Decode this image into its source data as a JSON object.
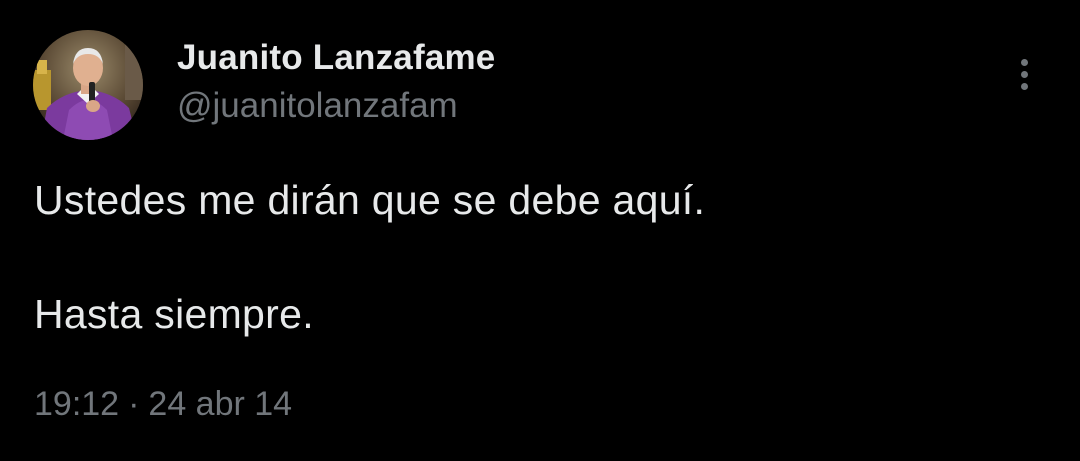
{
  "author": {
    "display_name": "Juanito Lanzafame",
    "handle": "@juanitolanzafam",
    "avatar_icon": "priest-portrait-avatar"
  },
  "menu": {
    "icon": "more-vertical-icon"
  },
  "tweet": {
    "lines": [
      "Ustedes me dirán que se debe aquí.",
      "Hasta siempre."
    ],
    "time": "19:12",
    "separator": "·",
    "date": "24 abr 14"
  },
  "colors": {
    "background": "#000000",
    "primary_text": "#e7e9ea",
    "secondary_text": "#71767b",
    "vestment_purple": "#7b3a9e"
  }
}
